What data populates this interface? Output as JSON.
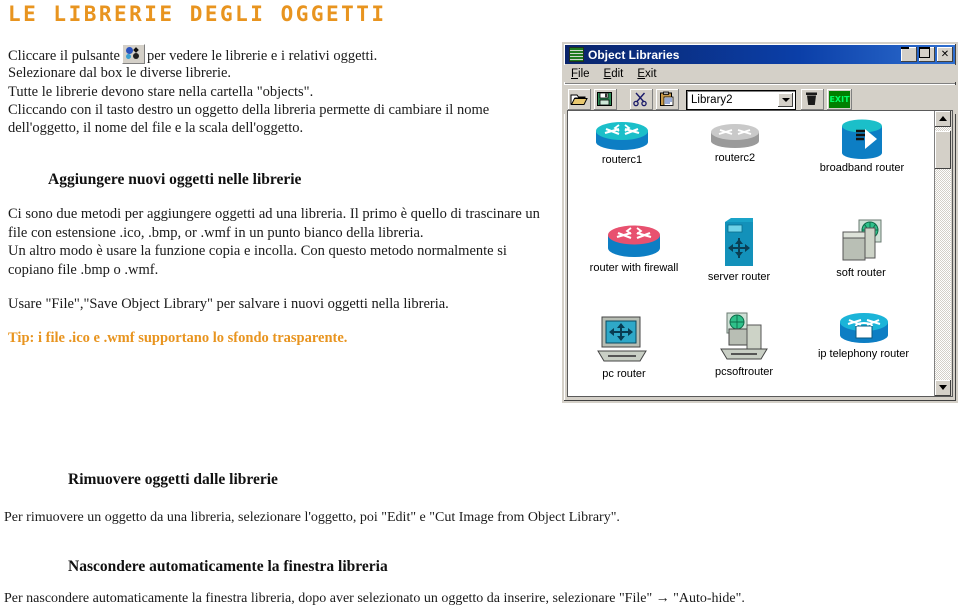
{
  "page": {
    "title": "LE LIBRERIE DEGLI OGGETTI",
    "title_color": "#E8941F"
  },
  "intro": {
    "line1_before": "Cliccare il pulsante",
    "line1_after": "per vedere le librerie e i relativi oggetti.",
    "line2": "Selezionare dal box le diverse librerie.",
    "line3": "Tutte le librerie devono stare nella cartella \"objects\".",
    "line4": "Cliccando con il tasto destro un oggetto della libreria permette di cambiare il nome",
    "line5": "dell'oggetto, il nome del file e la scala dell'oggetto."
  },
  "section_add": {
    "heading": "Aggiungere nuovi oggetti  nelle librerie",
    "p1_l1": "Ci sono due metodi per aggiungere oggetti ad una libreria. Il primo è quello di trascinare un",
    "p1_l2": "file con estensione .ico, .bmp, or .wmf in un punto bianco della libreria.",
    "p1_l3": "Un altro modo è usare la funzione copia e incolla. Con questo metodo normalmente si",
    "p1_l4": "copiano file  .bmp o .wmf.",
    "p2": "Usare  \"File\",\"Save Object Library\" per salvare i nuovi oggetti nella libreria.",
    "tip": "Tip: i file .ico e .wmf supportano lo sfondo trasparente.",
    "tip_color": "#E8941F"
  },
  "section_remove": {
    "heading": "Rimuovere oggetti dalle librerie",
    "body": "Per  rimuovere un oggetto da una libreria, selezionare l'oggetto, poi \"Edit\" e \"Cut Image from Object Library\"."
  },
  "section_autohide": {
    "heading": "Nascondere automaticamente la finestra libreria",
    "body": "Per nascondere automaticamente la finestra libreria, dopo aver selezionato un oggetto da inserire, selezionare  \"File\" → \"Auto-hide\"."
  },
  "window": {
    "title": "Object Libraries",
    "title_icon": "grid-icon",
    "titlebar_color": "#0a246a",
    "controls": {
      "minimize": "minimize-icon",
      "maximize": "maximize-icon",
      "close": "✕"
    },
    "menu": [
      {
        "label": "File",
        "accel": "F"
      },
      {
        "label": "Edit",
        "accel": "E"
      },
      {
        "label": "Exit",
        "accel": "E"
      }
    ],
    "toolbar": {
      "open_icon": "open-folder-icon",
      "save_icon": "floppy-save-icon",
      "cut_icon": "scissors-icon",
      "paste_icon": "clipboard-paste-icon",
      "library_value": "Library2",
      "library_options": [
        "Library2"
      ],
      "delete_icon": "trash-can-icon",
      "exit_label": "EXIT",
      "exit_color": "#008000"
    },
    "icons": [
      {
        "name": "routerc1",
        "glyph": "router-cyan-icon",
        "col": 0,
        "row": 0
      },
      {
        "name": "routerc2",
        "glyph": "router-gray-icon",
        "col": 1,
        "row": 0
      },
      {
        "name": "broadband router",
        "glyph": "broadband-router-icon",
        "col": 2,
        "row": 0
      },
      {
        "name": "router with firewall",
        "glyph": "router-firewall-icon",
        "col": 0,
        "row": 1
      },
      {
        "name": "server router",
        "glyph": "server-router-icon",
        "col": 1,
        "row": 1
      },
      {
        "name": "soft router",
        "glyph": "soft-router-icon",
        "col": 2,
        "row": 1
      },
      {
        "name": "pc router",
        "glyph": "pc-router-icon",
        "col": 0,
        "row": 2
      },
      {
        "name": "pcsoftrouter",
        "glyph": "pcsoft-router-icon",
        "col": 1,
        "row": 2
      },
      {
        "name": "ip telephony router",
        "glyph": "ip-telephony-router-icon",
        "col": 2,
        "row": 2
      }
    ],
    "scrollbar": {
      "up": "scroll-up-icon",
      "down": "scroll-down-icon"
    }
  }
}
